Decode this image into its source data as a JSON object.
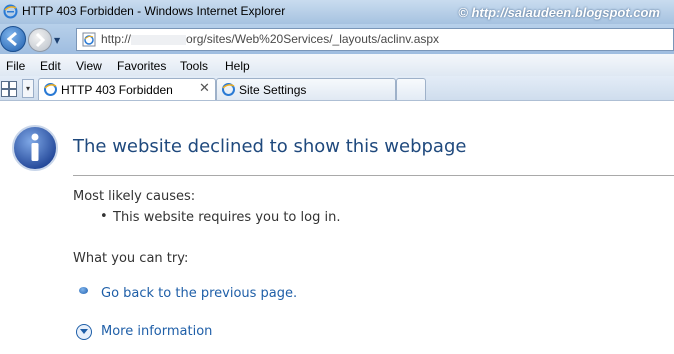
{
  "window": {
    "title": "HTTP 403 Forbidden - Windows Internet Explorer",
    "watermark": "© http://salaudeen.blogspot.com"
  },
  "address": {
    "prefix": "http://",
    "suffix": "org/sites/Web%20Services/_layouts/aclinv.aspx"
  },
  "menu": {
    "items": [
      "File",
      "Edit",
      "View",
      "Favorites",
      "Tools",
      "Help"
    ]
  },
  "tabs": [
    {
      "label": "HTTP 403 Forbidden",
      "active": true
    },
    {
      "label": "Site Settings",
      "active": false
    }
  ],
  "page": {
    "heading": "The website declined to show this webpage",
    "causes_label": "Most likely causes:",
    "causes": [
      "This website requires you to log in."
    ],
    "try_label": "What you can try:",
    "back_link": "Go back to the previous page.",
    "more_info": "More information"
  },
  "colors": {
    "heading": "#1f497d",
    "link": "#1f5fa8"
  }
}
